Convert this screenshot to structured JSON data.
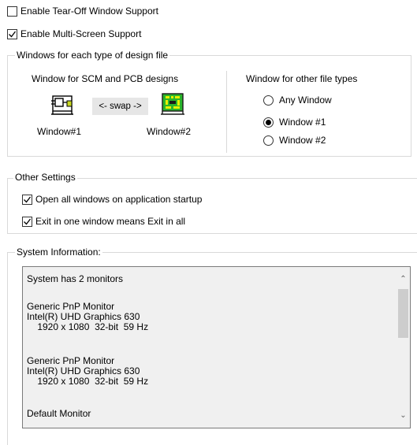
{
  "checkboxes": {
    "tearoff": {
      "label": "Enable Tear-Off Window Support",
      "checked": false
    },
    "multiscreen": {
      "label": "Enable Multi-Screen Support",
      "checked": true
    }
  },
  "windows_group": {
    "legend": "Windows for each type of design file",
    "scm_pcb_title": "Window for SCM and PCB designs",
    "swap_label": "<- swap ->",
    "window1_label": "Window#1",
    "window2_label": "Window#2",
    "other_title": "Window for other file types",
    "radios": [
      {
        "label": "Any Window",
        "selected": false
      },
      {
        "label": "Window #1",
        "selected": true
      },
      {
        "label": "Window #2",
        "selected": false
      }
    ]
  },
  "other_settings": {
    "legend": "Other Settings",
    "open_all": {
      "label": "Open all windows on application startup",
      "checked": true
    },
    "exit_all": {
      "label": "Exit in one window means Exit in all",
      "checked": true
    }
  },
  "system_info": {
    "legend": "System Information:",
    "lines": [
      "System has 2 monitors",
      "",
      "Generic PnP Monitor",
      "Intel(R) UHD Graphics 630",
      "    1920 x 1080  32-bit  59 Hz",
      "",
      "Generic PnP Monitor",
      "Intel(R) UHD Graphics 630",
      "    1920 x 1080  32-bit  59 Hz",
      "",
      "Default Monitor"
    ]
  },
  "icons": {
    "window1": "schematic-icon",
    "window2": "pcb-icon",
    "pcb_color": "#2bb52b",
    "schematic_color": "#c8d820"
  }
}
